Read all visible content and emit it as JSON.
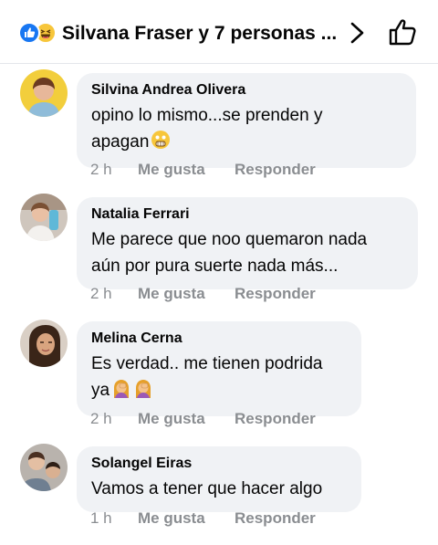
{
  "header": {
    "title": "Silvana Fraser y 7 personas ...",
    "reaction_icons": [
      "like-reaction-icon",
      "haha-reaction-icon"
    ],
    "nav_icon": "chevron-right-icon",
    "like_icon": "thumbs-up-icon"
  },
  "colors": {
    "bubble": "#f0f2f5",
    "meta": "#8a8d91",
    "like_blue": "#1877f2"
  },
  "comments": [
    {
      "author": "Silvina Andrea Olivera",
      "line1": "opino lo mismo...se prenden y",
      "line2": "apagan",
      "emoji": "scream-emoji",
      "time": "2 h",
      "like_label": "Me gusta",
      "reply_label": "Responder"
    },
    {
      "author": "Natalia Ferrari",
      "line1": "Me parece que noo quemaron nada",
      "line2": "aún por pura suerte nada más...",
      "time": "2 h",
      "like_label": "Me gusta",
      "reply_label": "Responder"
    },
    {
      "author": "Melina Cerna",
      "line1": "Es verdad.. me tienen podrida",
      "line2": "ya",
      "emoji": "facepalm-woman-emoji",
      "time": "2 h",
      "like_label": "Me gusta",
      "reply_label": "Responder"
    },
    {
      "author": "Solangel Eiras",
      "line1": "Vamos a tener que hacer algo",
      "time": "1 h",
      "like_label": "Me gusta",
      "reply_label": "Responder"
    }
  ]
}
